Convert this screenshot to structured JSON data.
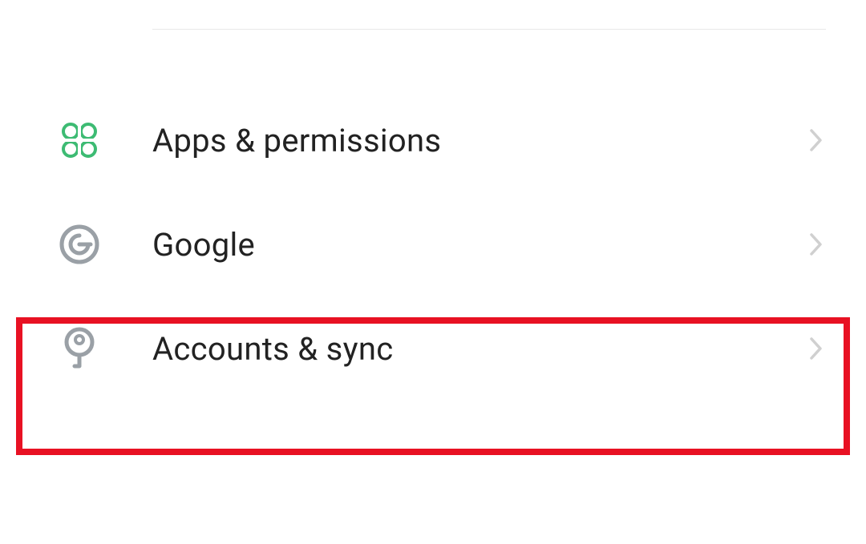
{
  "settings": {
    "items": [
      {
        "label": "Apps & permissions",
        "icon": "apps-permissions-icon",
        "iconColor": "#3dbb73"
      },
      {
        "label": "Google",
        "icon": "google-icon",
        "iconColor": "#9aa0a6"
      },
      {
        "label": "Accounts & sync",
        "icon": "key-icon",
        "iconColor": "#9aa0a6"
      }
    ]
  },
  "highlightedIndex": 2
}
